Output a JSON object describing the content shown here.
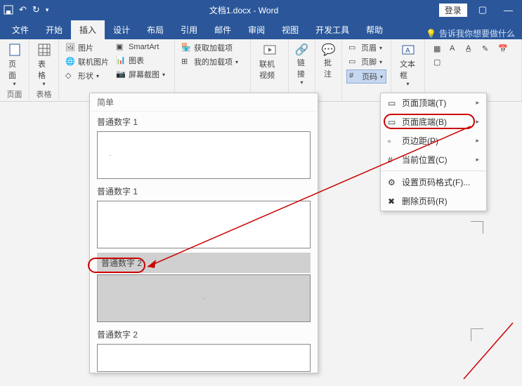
{
  "titlebar": {
    "doc_name": "文档1.docx - Word",
    "login": "登录"
  },
  "tabs": {
    "file": "文件",
    "home": "开始",
    "insert": "插入",
    "design": "设计",
    "layout": "布局",
    "references": "引用",
    "mailings": "邮件",
    "review": "审阅",
    "view": "视图",
    "developer": "开发工具",
    "help": "帮助",
    "tellme": "告诉我你想要做什么"
  },
  "ribbon": {
    "page_group": "页面",
    "table_group": "表格",
    "cover_page": "页面",
    "table": "表格",
    "pictures": "图片",
    "online_pictures": "联机图片",
    "shapes": "形状",
    "smartart": "SmartArt",
    "chart": "图表",
    "screenshot": "屏幕截图",
    "get_addins": "获取加载项",
    "my_addins": "我的加载项",
    "online_video": "联机视频",
    "links": "链接",
    "comment": "批注",
    "header": "页眉",
    "footer": "页脚",
    "page_number": "页码",
    "textbox": "文本框"
  },
  "gallery": {
    "simple": "简单",
    "plain1": "普通数字 1",
    "plain1b": "普通数字 1",
    "plain2": "普通数字 2",
    "plain2b": "普通数字 2"
  },
  "pagenum_menu": {
    "top": "页面顶端(T)",
    "bottom": "页面底端(B)",
    "margins": "页边距(P)",
    "current": "当前位置(C)",
    "format": "设置页码格式(F)...",
    "remove": "删除页码(R)"
  }
}
